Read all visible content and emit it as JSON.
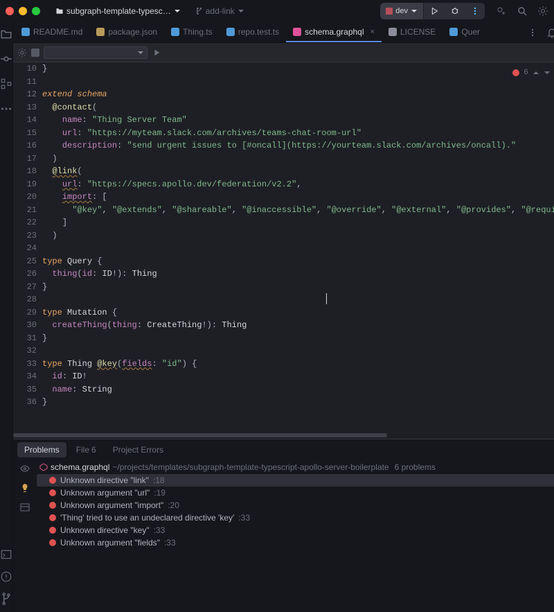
{
  "title": {
    "project": "subgraph-template-typesc…",
    "branch": "add-link",
    "run_config": "dev"
  },
  "tabs": [
    {
      "icon": "md",
      "label": "README.md",
      "active": false
    },
    {
      "icon": "json",
      "label": "package.json",
      "active": false
    },
    {
      "icon": "ts",
      "label": "Thing.ts",
      "active": false
    },
    {
      "icon": "ts",
      "label": "repo.test.ts",
      "active": false
    },
    {
      "icon": "gql",
      "label": "schema.graphql",
      "active": true
    },
    {
      "icon": "txt",
      "label": "LICENSE",
      "active": false
    },
    {
      "icon": "ts",
      "label": "Quer",
      "active": false
    }
  ],
  "error_count": "6",
  "lines": [
    {
      "n": 10,
      "seg": [
        {
          "c": "punc",
          "t": "}"
        },
        {
          "c": "text-dim",
          "t": ""
        }
      ]
    },
    {
      "n": 11,
      "seg": []
    },
    {
      "n": 12,
      "seg": [
        {
          "c": "kw",
          "t": "extend"
        },
        {
          "c": "",
          "t": " "
        },
        {
          "c": "kw",
          "t": "schema"
        }
      ]
    },
    {
      "n": 13,
      "seg": [
        {
          "c": "",
          "t": "  "
        },
        {
          "c": "dir",
          "t": "@contact"
        },
        {
          "c": "punc",
          "t": "("
        }
      ]
    },
    {
      "n": 14,
      "seg": [
        {
          "c": "",
          "t": "    "
        },
        {
          "c": "fld",
          "t": "name"
        },
        {
          "c": "punc",
          "t": ": "
        },
        {
          "c": "str",
          "t": "\"Thing Server Team\""
        }
      ]
    },
    {
      "n": 15,
      "seg": [
        {
          "c": "",
          "t": "    "
        },
        {
          "c": "fld",
          "t": "url"
        },
        {
          "c": "punc",
          "t": ": "
        },
        {
          "c": "str",
          "t": "\"https://myteam.slack.com/archives/teams-chat-room-url\""
        }
      ]
    },
    {
      "n": 16,
      "seg": [
        {
          "c": "",
          "t": "    "
        },
        {
          "c": "fld",
          "t": "description"
        },
        {
          "c": "punc",
          "t": ": "
        },
        {
          "c": "str",
          "t": "\"send urgent issues to [#oncall](https://yourteam.slack.com/archives/oncall).\""
        }
      ]
    },
    {
      "n": 17,
      "seg": [
        {
          "c": "",
          "t": "  "
        },
        {
          "c": "punc",
          "t": ")"
        }
      ]
    },
    {
      "n": 18,
      "seg": [
        {
          "c": "",
          "t": "  "
        },
        {
          "c": "dir wavy",
          "t": "@link"
        },
        {
          "c": "punc",
          "t": "("
        }
      ]
    },
    {
      "n": 19,
      "seg": [
        {
          "c": "",
          "t": "    "
        },
        {
          "c": "fld wavy",
          "t": "url"
        },
        {
          "c": "punc",
          "t": ": "
        },
        {
          "c": "str",
          "t": "\"https://specs.apollo.dev/federation/v2.2\""
        },
        {
          "c": "punc",
          "t": ","
        }
      ]
    },
    {
      "n": 20,
      "seg": [
        {
          "c": "",
          "t": "    "
        },
        {
          "c": "fld wavy",
          "t": "import"
        },
        {
          "c": "punc",
          "t": ": ["
        }
      ]
    },
    {
      "n": 21,
      "seg": [
        {
          "c": "",
          "t": "      "
        },
        {
          "c": "str",
          "t": "\"@key\""
        },
        {
          "c": "punc",
          "t": ", "
        },
        {
          "c": "str",
          "t": "\"@extends\""
        },
        {
          "c": "punc",
          "t": ", "
        },
        {
          "c": "str",
          "t": "\"@shareable\""
        },
        {
          "c": "punc",
          "t": ", "
        },
        {
          "c": "str",
          "t": "\"@inaccessible\""
        },
        {
          "c": "punc",
          "t": ", "
        },
        {
          "c": "str",
          "t": "\"@override\""
        },
        {
          "c": "punc",
          "t": ", "
        },
        {
          "c": "str",
          "t": "\"@external\""
        },
        {
          "c": "punc",
          "t": ", "
        },
        {
          "c": "str",
          "t": "\"@provides\""
        },
        {
          "c": "punc",
          "t": ", "
        },
        {
          "c": "str",
          "t": "\"@requi"
        }
      ]
    },
    {
      "n": 22,
      "seg": [
        {
          "c": "",
          "t": "    "
        },
        {
          "c": "punc",
          "t": "]"
        }
      ]
    },
    {
      "n": 23,
      "seg": [
        {
          "c": "",
          "t": "  "
        },
        {
          "c": "punc",
          "t": ")"
        }
      ]
    },
    {
      "n": 24,
      "seg": []
    },
    {
      "n": 25,
      "seg": [
        {
          "c": "kw2",
          "t": "type"
        },
        {
          "c": "",
          "t": " "
        },
        {
          "c": "typ",
          "t": "Query"
        },
        {
          "c": "",
          "t": " "
        },
        {
          "c": "punc",
          "t": "{"
        }
      ]
    },
    {
      "n": 26,
      "seg": [
        {
          "c": "",
          "t": "  "
        },
        {
          "c": "fld",
          "t": "thing"
        },
        {
          "c": "punc",
          "t": "("
        },
        {
          "c": "fld",
          "t": "id"
        },
        {
          "c": "punc",
          "t": ": "
        },
        {
          "c": "typ",
          "t": "ID"
        },
        {
          "c": "red",
          "t": "!"
        },
        {
          "c": "punc",
          "t": "): "
        },
        {
          "c": "typ",
          "t": "Thing"
        }
      ]
    },
    {
      "n": 27,
      "seg": [
        {
          "c": "punc",
          "t": "}"
        }
      ]
    },
    {
      "n": 28,
      "seg": []
    },
    {
      "n": 29,
      "seg": [
        {
          "c": "kw2",
          "t": "type"
        },
        {
          "c": "",
          "t": " "
        },
        {
          "c": "typ",
          "t": "Mutation"
        },
        {
          "c": "",
          "t": " "
        },
        {
          "c": "punc",
          "t": "{"
        }
      ]
    },
    {
      "n": 30,
      "seg": [
        {
          "c": "",
          "t": "  "
        },
        {
          "c": "fld",
          "t": "createThing"
        },
        {
          "c": "punc",
          "t": "("
        },
        {
          "c": "fld",
          "t": "thing"
        },
        {
          "c": "punc",
          "t": ": "
        },
        {
          "c": "typ",
          "t": "CreateThing"
        },
        {
          "c": "red",
          "t": "!"
        },
        {
          "c": "punc",
          "t": "): "
        },
        {
          "c": "typ",
          "t": "Thing"
        }
      ]
    },
    {
      "n": 31,
      "seg": [
        {
          "c": "punc",
          "t": "}"
        }
      ]
    },
    {
      "n": 32,
      "seg": []
    },
    {
      "n": 33,
      "seg": [
        {
          "c": "kw2",
          "t": "type"
        },
        {
          "c": "",
          "t": " "
        },
        {
          "c": "typ",
          "t": "Thing"
        },
        {
          "c": "",
          "t": " "
        },
        {
          "c": "dir wavy",
          "t": "@key"
        },
        {
          "c": "punc",
          "t": "("
        },
        {
          "c": "fld wavy",
          "t": "fields"
        },
        {
          "c": "punc",
          "t": ": "
        },
        {
          "c": "str",
          "t": "\"id\""
        },
        {
          "c": "punc",
          "t": ") {"
        }
      ]
    },
    {
      "n": 34,
      "seg": [
        {
          "c": "",
          "t": "  "
        },
        {
          "c": "fld",
          "t": "id"
        },
        {
          "c": "punc",
          "t": ": "
        },
        {
          "c": "typ",
          "t": "ID"
        },
        {
          "c": "red",
          "t": "!"
        }
      ]
    },
    {
      "n": 35,
      "seg": [
        {
          "c": "",
          "t": "  "
        },
        {
          "c": "fld",
          "t": "name"
        },
        {
          "c": "punc",
          "t": ": "
        },
        {
          "c": "typ",
          "t": "String"
        }
      ]
    },
    {
      "n": 36,
      "seg": [
        {
          "c": "punc",
          "t": "}"
        }
      ]
    }
  ],
  "panel": {
    "tabs": {
      "problems": "Problems",
      "file": "File",
      "file_count": "6",
      "project": "Project Errors"
    },
    "file_head": {
      "name": "schema.graphql",
      "path": "~/projects/templates/subgraph-template-typescript-apollo-server-boilerplate",
      "count": "6 problems"
    },
    "problems": [
      {
        "msg": "Unknown directive \"link\"",
        "line": ":18",
        "hl": true
      },
      {
        "msg": "Unknown argument \"url\"",
        "line": ":19"
      },
      {
        "msg": "Unknown argument \"import\"",
        "line": ":20"
      },
      {
        "msg": "'Thing' tried to use an undeclared directive 'key'",
        "line": ":33"
      },
      {
        "msg": "Unknown directive \"key\"",
        "line": ":33"
      },
      {
        "msg": "Unknown argument \"fields\"",
        "line": ":33"
      }
    ]
  }
}
